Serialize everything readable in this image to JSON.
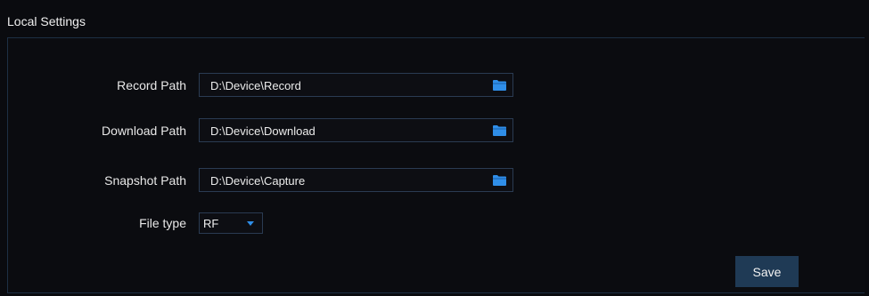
{
  "header": {
    "title": "Local Settings"
  },
  "fields": {
    "record": {
      "label": "Record Path",
      "value": "D:\\Device\\Record",
      "icon": "folder-icon"
    },
    "download": {
      "label": "Download Path",
      "value": "D:\\Device\\Download",
      "icon": "folder-icon"
    },
    "snapshot": {
      "label": "Snapshot Path",
      "value": "D:\\Device\\Capture",
      "icon": "folder-icon"
    },
    "file_type": {
      "label": "File type",
      "selected": "RF",
      "icon": "chevron-down-icon"
    }
  },
  "actions": {
    "save_label": "Save"
  },
  "colors": {
    "background": "#0a0b0f",
    "accent": "#2f8ee8",
    "button": "#1f3a55",
    "border": "#2a3b52"
  }
}
